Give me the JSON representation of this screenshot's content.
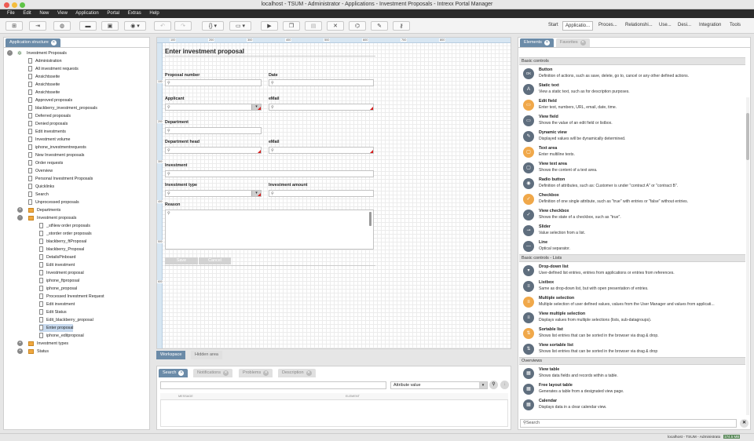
{
  "window": {
    "title": "localhost - TSUM - Administrator - Applications - Investment Proposals - Intrexx Portal Manager"
  },
  "menu": [
    "File",
    "Edit",
    "New",
    "View",
    "Application",
    "Portal",
    "Extras",
    "Help"
  ],
  "toolbar": {
    "icons": [
      "new-app-icon",
      "import-icon",
      "globe-icon",
      "folder-icon",
      "save-icon",
      "settings-dropdown-icon",
      "undo-icon",
      "redo-icon",
      "braces-icon",
      "monitor-icon",
      "play-icon",
      "copy-icon",
      "lock-icon",
      "delete-icon",
      "hierarchy-icon",
      "pen-icon",
      "key-icon"
    ],
    "braces_label": "{}",
    "nav": [
      "Start",
      "Applicatio...",
      "Proces...",
      "Relationshi...",
      "Use...",
      "Desi...",
      "Integration",
      "Tools"
    ]
  },
  "left_panel": {
    "tab": "Application structure",
    "tree": [
      {
        "label": "Investment Proposals",
        "depth": 0,
        "type": "app"
      },
      {
        "label": "Administration",
        "depth": 1,
        "type": "page"
      },
      {
        "label": "All investment requests",
        "depth": 1,
        "type": "page"
      },
      {
        "label": "Ansichtsseite",
        "depth": 1,
        "type": "page"
      },
      {
        "label": "Ansichtsseite",
        "depth": 1,
        "type": "page"
      },
      {
        "label": "Ansichtsseite",
        "depth": 1,
        "type": "page"
      },
      {
        "label": "Approved proposals",
        "depth": 1,
        "type": "page"
      },
      {
        "label": "blackberry_investment_proposals",
        "depth": 1,
        "type": "page"
      },
      {
        "label": "Deferred proposals",
        "depth": 1,
        "type": "page"
      },
      {
        "label": "Denied proposals",
        "depth": 1,
        "type": "page"
      },
      {
        "label": "Edit investments",
        "depth": 1,
        "type": "page"
      },
      {
        "label": "Investment volume",
        "depth": 1,
        "type": "page"
      },
      {
        "label": "iphone_investmentrequests",
        "depth": 1,
        "type": "page"
      },
      {
        "label": "New Investment proposals",
        "depth": 1,
        "type": "page"
      },
      {
        "label": "Order requests",
        "depth": 1,
        "type": "page"
      },
      {
        "label": "Overview",
        "depth": 1,
        "type": "page"
      },
      {
        "label": "Personal Investment Proposals",
        "depth": 1,
        "type": "page"
      },
      {
        "label": "Quicklinks",
        "depth": 1,
        "type": "page"
      },
      {
        "label": "Search",
        "depth": 1,
        "type": "page"
      },
      {
        "label": "Unprocessed proposals",
        "depth": 1,
        "type": "page"
      },
      {
        "label": "Departments",
        "depth": 1,
        "type": "db",
        "expander": "+"
      },
      {
        "label": "Investment proposals",
        "depth": 1,
        "type": "db",
        "expander": "-"
      },
      {
        "label": "_stNew order proposals",
        "depth": 2,
        "type": "page"
      },
      {
        "label": "_storder order proposals",
        "depth": 2,
        "type": "page"
      },
      {
        "label": "blackberry_ftProposal",
        "depth": 2,
        "type": "page"
      },
      {
        "label": "blackberry_Proposal",
        "depth": 2,
        "type": "page"
      },
      {
        "label": "DetailsPinboard",
        "depth": 2,
        "type": "page"
      },
      {
        "label": "Edit investment",
        "depth": 2,
        "type": "page"
      },
      {
        "label": "Investment proposal",
        "depth": 2,
        "type": "page"
      },
      {
        "label": "iphone_ftproposal",
        "depth": 2,
        "type": "page"
      },
      {
        "label": "iphone_proposal",
        "depth": 2,
        "type": "page"
      },
      {
        "label": "Processed Investment Request",
        "depth": 2,
        "type": "page"
      },
      {
        "label": "Edit investment",
        "depth": 2,
        "type": "page"
      },
      {
        "label": "Edit Status",
        "depth": 2,
        "type": "page"
      },
      {
        "label": "Edit_blackberry_proposal",
        "depth": 2,
        "type": "page"
      },
      {
        "label": "Enter proposal",
        "depth": 2,
        "type": "page",
        "selected": true
      },
      {
        "label": "iphone_editproposal",
        "depth": 2,
        "type": "page"
      },
      {
        "label": "Investment types",
        "depth": 1,
        "type": "db",
        "expander": "+"
      },
      {
        "label": "Status",
        "depth": 1,
        "type": "db",
        "expander": "+"
      }
    ]
  },
  "workspace": {
    "ruler_top": [
      "100",
      "200",
      "300",
      "400",
      "500",
      "600",
      "700",
      "800"
    ],
    "ruler_left": [
      "100",
      "200",
      "300",
      "400",
      "500",
      "600"
    ],
    "form": {
      "title": "Enter investment proposal",
      "labels": {
        "proposal_number": "Proposal number",
        "date": "Date",
        "applicant": "Applicant",
        "email1": "eMail",
        "department": "Department",
        "department_head": "Department head",
        "email2": "eMail",
        "investment": "Investment",
        "investment_type": "Investment type",
        "investment_amount": "Investment amount",
        "reason": "Reason"
      },
      "buttons": {
        "save": "Save",
        "cancel": "Cancel"
      }
    },
    "tabs": [
      "Workspace",
      "Hidden area"
    ]
  },
  "bottom_panel": {
    "tabs": [
      "Search",
      "Notifications",
      "Problems",
      "Description"
    ],
    "search_value": "",
    "attribute_select": "Attribute value",
    "columns": [
      "MESSAGE",
      "ELEMENT"
    ]
  },
  "right_panel": {
    "tabs": [
      "Elements",
      "Favorites"
    ],
    "sections": [
      {
        "title": "Basic controls",
        "items": [
          {
            "name": "Button",
            "desc": "Definition of actions, such as save, delete, go to, cancel or any other defined actions.",
            "icon": "button-icon",
            "glyph": "OK",
            "orange": false
          },
          {
            "name": "Static text",
            "desc": "View a static text, such as for description purposes.",
            "icon": "static-text-icon",
            "glyph": "A",
            "orange": false
          },
          {
            "name": "Edit field",
            "desc": "Enter text, numbers, URL, email, date, time.",
            "icon": "edit-field-icon",
            "glyph": "▭",
            "orange": true
          },
          {
            "name": "View field",
            "desc": "Shows the value of an edit field or listbox.",
            "icon": "view-field-icon",
            "glyph": "▭",
            "orange": false
          },
          {
            "name": "Dynamic view",
            "desc": "Displayed values will be dynamically determined.",
            "icon": "dynamic-view-icon",
            "glyph": "✎",
            "orange": false
          },
          {
            "name": "Text area",
            "desc": "Enter multiline texts.",
            "icon": "text-area-icon",
            "glyph": "▢",
            "orange": true
          },
          {
            "name": "View text area",
            "desc": "Shows the content of a text area.",
            "icon": "view-text-area-icon",
            "glyph": "▢",
            "orange": false
          },
          {
            "name": "Radio button",
            "desc": "Definition of attributes, such as: Customer is under \"contract A\" or \"contract B\".",
            "icon": "radio-button-icon",
            "glyph": "◉",
            "orange": false
          },
          {
            "name": "Checkbox",
            "desc": "Definition of one single attribute, such as \"true\" with entries or \"false\" without entries.",
            "icon": "checkbox-icon",
            "glyph": "✓",
            "orange": true
          },
          {
            "name": "View checkbox",
            "desc": "Shows the state of a checkbox, such as \"true\".",
            "icon": "view-checkbox-icon",
            "glyph": "✓",
            "orange": false
          },
          {
            "name": "Slider",
            "desc": "Value selection from a list.",
            "icon": "slider-icon",
            "glyph": "⊸",
            "orange": false
          },
          {
            "name": "Line",
            "desc": "Optical separator.",
            "icon": "line-icon",
            "glyph": "—",
            "orange": false
          }
        ]
      },
      {
        "title": "Basic controls - Lists",
        "items": [
          {
            "name": "Drop-down list",
            "desc": "User-defined list entries, entries from applications or entries from references.",
            "icon": "drop-down-list-icon",
            "glyph": "▾",
            "orange": false
          },
          {
            "name": "Listbox",
            "desc": "Same as drop-down list, but with open presentation of entries.",
            "icon": "listbox-icon",
            "glyph": "≡",
            "orange": false
          },
          {
            "name": "Multiple selection",
            "desc": "Multiple selection of user defined values, values from the User Manager and values from applicati...",
            "icon": "multiple-selection-icon",
            "glyph": "≡",
            "orange": true
          },
          {
            "name": "View multiple selection",
            "desc": "Displays values from multiple selections (lists, sub-datagroups).",
            "icon": "view-multiple-selection-icon",
            "glyph": "≡",
            "orange": false
          },
          {
            "name": "Sortable list",
            "desc": "Shows list entries that can be sorted in the browser via drag & drop.",
            "icon": "sortable-list-icon",
            "glyph": "⇅",
            "orange": true
          },
          {
            "name": "View sortable list",
            "desc": "Shows list entries that can be sorted in the browser via drag & drop",
            "icon": "view-sortable-list-icon",
            "glyph": "⇅",
            "orange": false
          }
        ]
      },
      {
        "title": "Overviews",
        "items": [
          {
            "name": "View table",
            "desc": "Shows data fields and records within a table.",
            "icon": "view-table-icon",
            "glyph": "▦",
            "orange": false
          },
          {
            "name": "Free layout table",
            "desc": "Generates a table from a designated view page.",
            "icon": "free-layout-table-icon",
            "glyph": "▦",
            "orange": false
          },
          {
            "name": "Calendar",
            "desc": "Displays data in a clear calendar view.",
            "icon": "calendar-icon",
            "glyph": "▦",
            "orange": false
          }
        ]
      }
    ],
    "search_placeholder": "Search"
  },
  "statusbar": {
    "text": "localhost - TSUM - Administrato",
    "zoom": "174.5 MB"
  }
}
